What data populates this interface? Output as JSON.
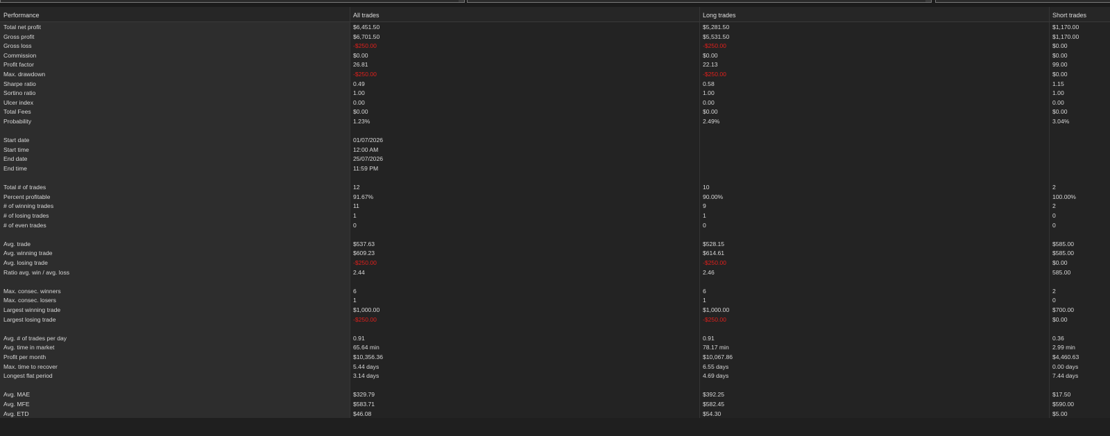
{
  "headers": {
    "label": "Performance",
    "all": "All trades",
    "long": "Long trades",
    "short": "Short trades"
  },
  "rows": [
    {
      "label": "Total net profit",
      "all": "$6,451.50",
      "long": "$5,281.50",
      "short": "$1,170.00"
    },
    {
      "label": "Gross profit",
      "all": "$6,701.50",
      "long": "$5,531.50",
      "short": "$1,170.00"
    },
    {
      "label": "Gross loss",
      "all": "-$250.00",
      "long": "-$250.00",
      "short": "$0.00"
    },
    {
      "label": "Commission",
      "all": "$0.00",
      "long": "$0.00",
      "short": "$0.00"
    },
    {
      "label": "Profit factor",
      "all": "26.81",
      "long": "22.13",
      "short": "99.00"
    },
    {
      "label": "Max. drawdown",
      "all": "-$250.00",
      "long": "-$250.00",
      "short": "$0.00"
    },
    {
      "label": "Sharpe ratio",
      "all": "0.49",
      "long": "0.58",
      "short": "1.15"
    },
    {
      "label": "Sortino ratio",
      "all": "1.00",
      "long": "1.00",
      "short": "1.00"
    },
    {
      "label": "Ulcer index",
      "all": "0.00",
      "long": "0.00",
      "short": "0.00"
    },
    {
      "label": "Total Fees",
      "all": "$0.00",
      "long": "$0.00",
      "short": "$0.00"
    },
    {
      "label": "Probability",
      "all": "1.23%",
      "long": "2.49%",
      "short": "3.04%"
    },
    {
      "label": "",
      "all": "",
      "long": "",
      "short": ""
    },
    {
      "label": "Start date",
      "all": "01/07/2026",
      "long": "",
      "short": ""
    },
    {
      "label": "Start time",
      "all": "12:00 AM",
      "long": "",
      "short": ""
    },
    {
      "label": "End date",
      "all": "25/07/2026",
      "long": "",
      "short": ""
    },
    {
      "label": "End time",
      "all": "11:59 PM",
      "long": "",
      "short": ""
    },
    {
      "label": "",
      "all": "",
      "long": "",
      "short": ""
    },
    {
      "label": "Total # of trades",
      "all": "12",
      "long": "10",
      "short": "2"
    },
    {
      "label": "Percent profitable",
      "all": "91.67%",
      "long": "90.00%",
      "short": "100.00%"
    },
    {
      "label": "# of winning trades",
      "all": "11",
      "long": "9",
      "short": "2"
    },
    {
      "label": "# of losing trades",
      "all": "1",
      "long": "1",
      "short": "0"
    },
    {
      "label": "# of even trades",
      "all": "0",
      "long": "0",
      "short": "0"
    },
    {
      "label": "",
      "all": "",
      "long": "",
      "short": ""
    },
    {
      "label": "Avg. trade",
      "all": "$537.63",
      "long": "$528.15",
      "short": "$585.00"
    },
    {
      "label": "Avg. winning trade",
      "all": "$609.23",
      "long": "$614.61",
      "short": "$585.00"
    },
    {
      "label": "Avg. losing trade",
      "all": "-$250.00",
      "long": "-$250.00",
      "short": "$0.00"
    },
    {
      "label": "Ratio avg. win / avg. loss",
      "all": "2.44",
      "long": "2.46",
      "short": "585.00"
    },
    {
      "label": "",
      "all": "",
      "long": "",
      "short": ""
    },
    {
      "label": "Max. consec. winners",
      "all": "6",
      "long": "6",
      "short": "2"
    },
    {
      "label": "Max. consec. losers",
      "all": "1",
      "long": "1",
      "short": "0"
    },
    {
      "label": "Largest winning trade",
      "all": "$1,000.00",
      "long": "$1,000.00",
      "short": "$700.00"
    },
    {
      "label": "Largest losing trade",
      "all": "-$250.00",
      "long": "-$250.00",
      "short": "$0.00"
    },
    {
      "label": "",
      "all": "",
      "long": "",
      "short": ""
    },
    {
      "label": "Avg. # of trades per day",
      "all": "0.91",
      "long": "0.91",
      "short": "0.36"
    },
    {
      "label": "Avg. time in market",
      "all": "65.64 min",
      "long": "78.17 min",
      "short": "2.99 min"
    },
    {
      "label": "Profit per month",
      "all": "$10,356.36",
      "long": "$10,067.86",
      "short": "$4,460.63"
    },
    {
      "label": "Max. time to recover",
      "all": "5.44 days",
      "long": "6.55 days",
      "short": "0.00 days"
    },
    {
      "label": "Longest flat period",
      "all": "3.14 days",
      "long": "4.69 days",
      "short": "7.44 days"
    },
    {
      "label": "",
      "all": "",
      "long": "",
      "short": ""
    },
    {
      "label": "Avg. MAE",
      "all": "$329.79",
      "long": "$392.25",
      "short": "$17.50"
    },
    {
      "label": "Avg. MFE",
      "all": "$583.71",
      "long": "$582.45",
      "short": "$590.00"
    },
    {
      "label": "Avg. ETD",
      "all": "$46.08",
      "long": "$54.30",
      "short": "$5.00"
    }
  ],
  "colors": {
    "negative": "#e0201c",
    "background": "#232323",
    "label_column": "#2d2d2d"
  }
}
